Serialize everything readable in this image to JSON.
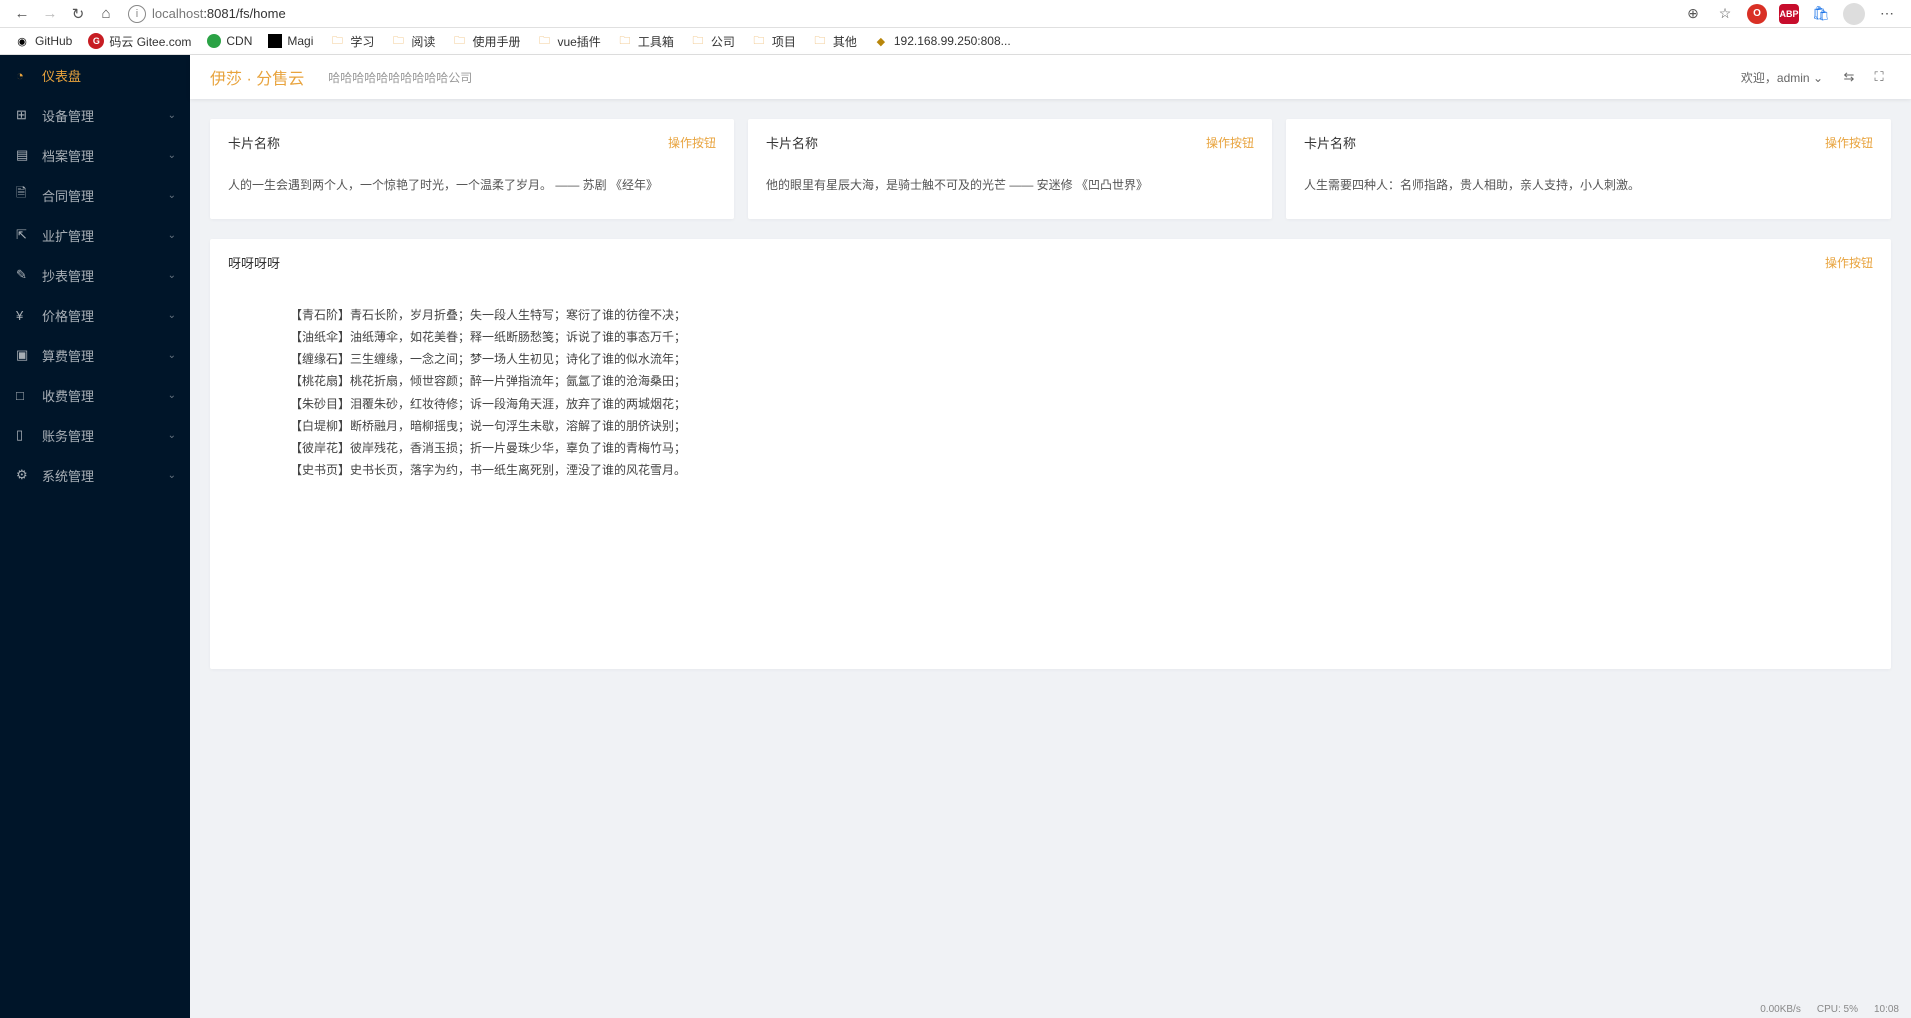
{
  "browser": {
    "url_host": "localhost",
    "url_path": ":8081/fs/home"
  },
  "bookmarks": [
    {
      "icon": "github",
      "label": "GitHub"
    },
    {
      "icon": "gitee",
      "label": "码云 Gitee.com"
    },
    {
      "icon": "cdn",
      "label": "CDN"
    },
    {
      "icon": "magi",
      "label": "Magi"
    },
    {
      "icon": "folder",
      "label": "学习"
    },
    {
      "icon": "folder",
      "label": "阅读"
    },
    {
      "icon": "folder",
      "label": "使用手册"
    },
    {
      "icon": "folder",
      "label": "vue插件"
    },
    {
      "icon": "folder",
      "label": "工具箱"
    },
    {
      "icon": "folder",
      "label": "公司"
    },
    {
      "icon": "folder",
      "label": "项目"
    },
    {
      "icon": "folder",
      "label": "其他"
    },
    {
      "icon": "ip",
      "label": "192.168.99.250:808..."
    }
  ],
  "sidebar": {
    "items": [
      {
        "icon": "◔",
        "label": "仪表盘",
        "active": true,
        "expandable": false
      },
      {
        "icon": "⊞",
        "label": "设备管理",
        "expandable": true
      },
      {
        "icon": "▤",
        "label": "档案管理",
        "expandable": true
      },
      {
        "icon": "🗎",
        "label": "合同管理",
        "expandable": true
      },
      {
        "icon": "⇱",
        "label": "业扩管理",
        "expandable": true
      },
      {
        "icon": "✎",
        "label": "抄表管理",
        "expandable": true
      },
      {
        "icon": "¥",
        "label": "价格管理",
        "expandable": true
      },
      {
        "icon": "▣",
        "label": "算费管理",
        "expandable": true
      },
      {
        "icon": "□",
        "label": "收费管理",
        "expandable": true
      },
      {
        "icon": "▯",
        "label": "账务管理",
        "expandable": true
      },
      {
        "icon": "⚙",
        "label": "系统管理",
        "expandable": true
      }
    ]
  },
  "topbar": {
    "brand": "伊莎 · 分售云",
    "sub": "哈哈哈哈哈哈哈哈哈哈公司",
    "welcome_prefix": "欢迎，",
    "user": "admin"
  },
  "cards": [
    {
      "title": "卡片名称",
      "action": "操作按钮",
      "body": "人的一生会遇到两个人，一个惊艳了时光，一个温柔了岁月。 —— 苏剧 《经年》"
    },
    {
      "title": "卡片名称",
      "action": "操作按钮",
      "body": "他的眼里有星辰大海，是骑士触不可及的光芒 —— 安迷修 《凹凸世界》"
    },
    {
      "title": "卡片名称",
      "action": "操作按钮",
      "body": "人生需要四种人：名师指路，贵人相助，亲人支持，小人刺激。"
    }
  ],
  "big_card": {
    "title": "呀呀呀呀",
    "action": "操作按钮",
    "lines": [
      "【青石阶】青石长阶，岁月折叠；失一段人生特写；寒衍了谁的彷徨不决；",
      "【油纸伞】油纸薄伞，如花美眷；释一纸断肠愁笺；诉说了谁的事态万千；",
      "【缠缘石】三生缠缘，一念之间；梦一场人生初见；诗化了谁的似水流年；",
      "【桃花扇】桃花折扇，倾世容颜；醉一片弹指流年；氤氲了谁的沧海桑田；",
      "【朱砂目】泪覆朱砂，红妆待修；诉一段海角天涯，放弃了谁的两城烟花；",
      "【白堤柳】断桥融月，暗柳摇曳；说一句浮生未歇，溶解了谁的朋侪诀别；",
      "【彼岸花】彼岸残花，香消玉损；折一片曼珠少华，辜负了谁的青梅竹马；",
      "【史书页】史书长页，落字为约，书一纸生离死别，湮没了谁的风花雪月。"
    ]
  },
  "status": {
    "net": "0.00KB/s",
    "cpu": "CPU: 5%",
    "time": "10:08"
  }
}
